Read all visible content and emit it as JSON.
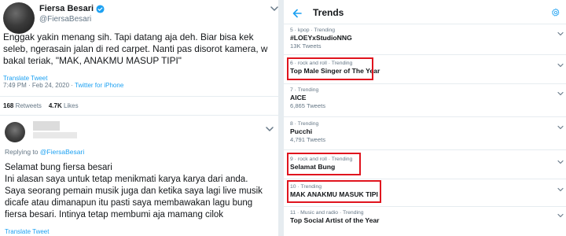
{
  "tweet": {
    "display_name": "Fiersa Besari",
    "handle": "@FiersaBesari",
    "lines": [
      "Enggak yakin menang sih. Tapi datang aja deh. Biar bisa kek",
      "seleb, ngerasain jalan di red carpet. Nanti pas disorot kamera, w",
      "bakal teriak, \"MAK, ANAKMU MASUP TIPI\""
    ],
    "translate_label": "Translate Tweet",
    "timestamp": "7:49 PM · Feb 24, 2020 · ",
    "client": "Twitter for iPhone",
    "retweets_count": "168",
    "retweets_label": " Retweets",
    "likes_count": "4.7K",
    "likes_label": " Likes"
  },
  "reply": {
    "replying_prefix": "Replying to ",
    "replying_handle": "@FiersaBesari",
    "lines": [
      "Selamat bung fiersa besari",
      "Ini alasan saya untuk tetap menikmati karya karya dari anda.",
      "Saya seorang pemain musik juga dan ketika saya lagi live musik",
      "dicafe atau dimanapun itu pasti saya membawakan lagu bung",
      "fiersa besari. Intinya tetap membumi aja mamang cilok"
    ],
    "translate_label": "Translate Tweet"
  },
  "trends_panel": {
    "title": "Trends",
    "items": [
      {
        "meta": "5 · kpop · Trending",
        "name": "#LOEYxStudioNNG",
        "count": "13K Tweets",
        "highlighted": false
      },
      {
        "meta": "6 · rock and roll · Trending",
        "name": "Top Male Singer of The Year",
        "count": "",
        "highlighted": true
      },
      {
        "meta": "7 · Trending",
        "name": "AICE",
        "count": "6,865 Tweets",
        "highlighted": false
      },
      {
        "meta": "8 · Trending",
        "name": "Pucchi",
        "count": "4,791 Tweets",
        "highlighted": false
      },
      {
        "meta": "9 · rock and roll · Trending",
        "name": "Selamat Bung",
        "count": "",
        "highlighted": true
      },
      {
        "meta": "10 · Trending",
        "name": "MAK ANAKMU MASUK TIPI",
        "count": "",
        "highlighted": true
      },
      {
        "meta": "11 · Music and radio · Trending",
        "name": "Top Social Artist of the Year",
        "count": "",
        "highlighted": false
      }
    ]
  },
  "colors": {
    "accent_blue": "#1da1f2",
    "highlight_red": "#e0141e",
    "muted_text": "#657786",
    "divider": "#e6ecf0"
  },
  "icons": [
    "verified-badge-icon",
    "chevron-down-icon",
    "back-arrow-icon",
    "gear-icon"
  ]
}
